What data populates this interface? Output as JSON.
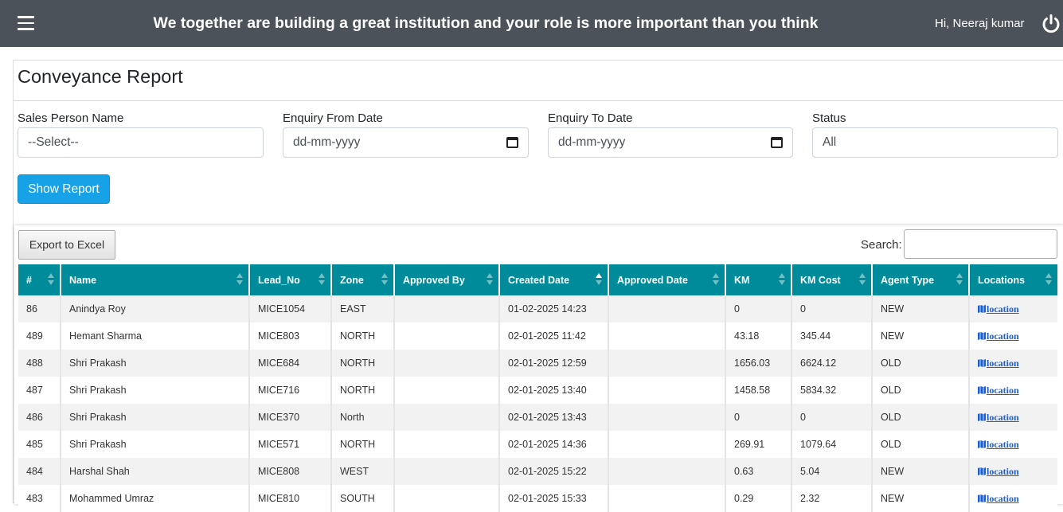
{
  "header": {
    "banner": "We together are building a great institution and your role is more important than you think",
    "greeting": "Hi, Neeraj kumar"
  },
  "page": {
    "title": "Conveyance Report"
  },
  "filters": {
    "sales_person": {
      "label": "Sales Person Name",
      "value": "--Select--"
    },
    "from_date": {
      "label": "Enquiry From Date",
      "value": "dd-mm-yyyy"
    },
    "to_date": {
      "label": "Enquiry To Date",
      "value": "dd-mm-yyyy"
    },
    "status": {
      "label": "Status",
      "value": "All"
    },
    "show_button": "Show Report"
  },
  "table_tools": {
    "export_label": "Export to Excel",
    "search_label": "Search:"
  },
  "colors": {
    "topbar": "#4b5259",
    "header_row": "#008b9a",
    "primary_button": "#17a2e8"
  },
  "table": {
    "sorted_column": "Created Date",
    "sort_direction": "ascending",
    "columns": [
      "#",
      "Name",
      "Lead_No",
      "Zone",
      "Approved By",
      "Created Date",
      "Approved Date",
      "KM",
      "KM Cost",
      "Agent Type",
      "Locations"
    ],
    "rows": [
      [
        "86",
        "Anindya Roy",
        "MICE1054",
        "EAST",
        "",
        "01-02-2025 14:23",
        "",
        "0",
        "0",
        "NEW",
        "location"
      ],
      [
        "489",
        "Hemant Sharma",
        "MICE803",
        "NORTH",
        "",
        "02-01-2025 11:42",
        "",
        "43.18",
        "345.44",
        "NEW",
        "location"
      ],
      [
        "488",
        "Shri Prakash",
        "MICE684",
        "NORTH",
        "",
        "02-01-2025 12:59",
        "",
        "1656.03",
        "6624.12",
        "OLD",
        "location"
      ],
      [
        "487",
        "Shri Prakash",
        "MICE716",
        "NORTH",
        "",
        "02-01-2025 13:40",
        "",
        "1458.58",
        "5834.32",
        "OLD",
        "location"
      ],
      [
        "486",
        "Shri Prakash",
        "MICE370",
        "North",
        "",
        "02-01-2025 13:43",
        "",
        "0",
        "0",
        "OLD",
        "location"
      ],
      [
        "485",
        "Shri Prakash",
        "MICE571",
        "NORTH",
        "",
        "02-01-2025 14:36",
        "",
        "269.91",
        "1079.64",
        "OLD",
        "location"
      ],
      [
        "484",
        "Harshal Shah",
        "MICE808",
        "WEST",
        "",
        "02-01-2025 15:22",
        "",
        "0.63",
        "5.04",
        "NEW",
        "location"
      ],
      [
        "483",
        "Mohammed Umraz",
        "MICE810",
        "SOUTH",
        "",
        "02-01-2025 15:33",
        "",
        "0.29",
        "2.32",
        "NEW",
        "location"
      ]
    ]
  }
}
